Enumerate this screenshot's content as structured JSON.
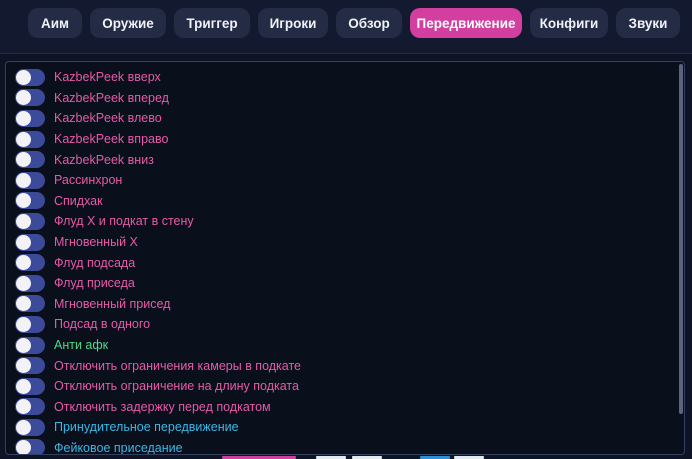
{
  "tabs": [
    {
      "label": "Аим",
      "active": false
    },
    {
      "label": "Оружие",
      "active": false
    },
    {
      "label": "Триггер",
      "active": false
    },
    {
      "label": "Игроки",
      "active": false
    },
    {
      "label": "Обзор",
      "active": false
    },
    {
      "label": "Передвижение",
      "active": true
    },
    {
      "label": "Конфиги",
      "active": false
    },
    {
      "label": "Звуки",
      "active": false
    }
  ],
  "colors": {
    "accent": "#d23f9e",
    "label_pink": "#e75aa8",
    "label_green": "#4fd989",
    "label_cyan": "#39b8e6",
    "toggle_track": "#3c4a9a"
  },
  "options": [
    {
      "label": "KazbekPeek вверх",
      "enabled": false,
      "color": "pink"
    },
    {
      "label": "KazbekPeek вперед",
      "enabled": false,
      "color": "pink"
    },
    {
      "label": "KazbekPeek влево",
      "enabled": false,
      "color": "pink"
    },
    {
      "label": "KazbekPeek вправо",
      "enabled": false,
      "color": "pink"
    },
    {
      "label": "KazbekPeek вниз",
      "enabled": false,
      "color": "pink"
    },
    {
      "label": "Рассинхрон",
      "enabled": false,
      "color": "pink"
    },
    {
      "label": "Спидхак",
      "enabled": false,
      "color": "pink"
    },
    {
      "label": "Флуд X и подкат в стену",
      "enabled": false,
      "color": "pink"
    },
    {
      "label": "Мгновенный X",
      "enabled": false,
      "color": "pink"
    },
    {
      "label": "Флуд подсада",
      "enabled": false,
      "color": "pink"
    },
    {
      "label": "Флуд приседа",
      "enabled": false,
      "color": "pink"
    },
    {
      "label": "Мгновенный присед",
      "enabled": false,
      "color": "pink"
    },
    {
      "label": "Подсад в одного",
      "enabled": false,
      "color": "pink"
    },
    {
      "label": "Анти афк",
      "enabled": false,
      "color": "green"
    },
    {
      "label": "Отключить ограничения камеры в подкате",
      "enabled": false,
      "color": "pink"
    },
    {
      "label": "Отключить ограничение на длину подката",
      "enabled": false,
      "color": "pink"
    },
    {
      "label": "Отключить задержку перед подкатом",
      "enabled": false,
      "color": "pink"
    },
    {
      "label": "Принудительное передвижение",
      "enabled": false,
      "color": "cyan"
    },
    {
      "label": "Фейковое приседание",
      "enabled": false,
      "color": "cyan"
    }
  ]
}
